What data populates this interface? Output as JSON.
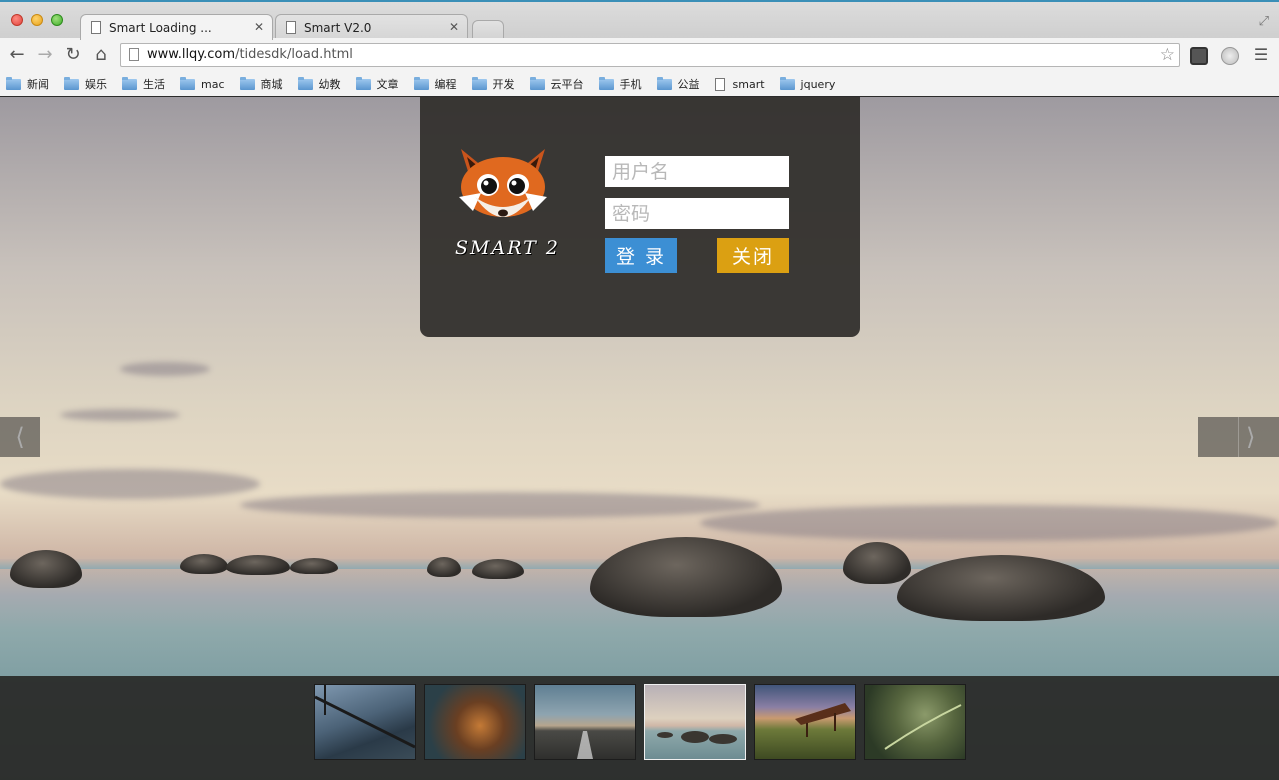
{
  "browser": {
    "tabs": [
      {
        "title": "Smart Loading ...",
        "active": true
      },
      {
        "title": "Smart V2.0",
        "active": false
      }
    ],
    "url_host": "www.llqy.com",
    "url_path": "/tidesdk/load.html",
    "bookmarks": [
      {
        "label": "新闻",
        "type": "folder"
      },
      {
        "label": "娱乐",
        "type": "folder"
      },
      {
        "label": "生活",
        "type": "folder"
      },
      {
        "label": "mac",
        "type": "folder"
      },
      {
        "label": "商城",
        "type": "folder"
      },
      {
        "label": "幼教",
        "type": "folder"
      },
      {
        "label": "文章",
        "type": "folder"
      },
      {
        "label": "编程",
        "type": "folder"
      },
      {
        "label": "开发",
        "type": "folder"
      },
      {
        "label": "云平台",
        "type": "folder"
      },
      {
        "label": "手机",
        "type": "folder"
      },
      {
        "label": "公益",
        "type": "folder"
      },
      {
        "label": "smart",
        "type": "page"
      },
      {
        "label": "jquery",
        "type": "folder"
      }
    ]
  },
  "login": {
    "brand": "SMART 2",
    "username_placeholder": "用户名",
    "password_placeholder": "密码",
    "login_label": "登 录",
    "close_label": "关闭",
    "login_color": "#3c8fd4",
    "close_color": "#dba012"
  },
  "slider": {
    "prev_icon": "chevron-left-icon",
    "next_icon": "chevron-right-icon",
    "active_index": 3,
    "thumbnails": [
      "bridge",
      "autumn-leaves",
      "road",
      "sea-rocks",
      "pier-meadow",
      "fern"
    ]
  }
}
